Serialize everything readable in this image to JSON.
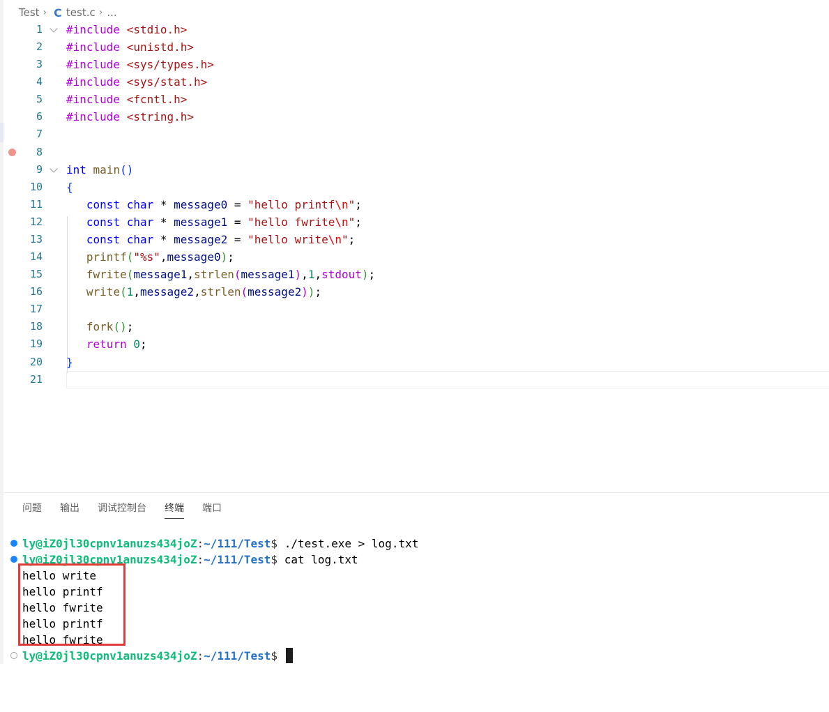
{
  "breadcrumb": {
    "folder": "Test",
    "file_icon": "C",
    "file": "test.c",
    "more": "..."
  },
  "editor": {
    "lines": [
      {
        "n": "1"
      },
      {
        "n": "2"
      },
      {
        "n": "3"
      },
      {
        "n": "4"
      },
      {
        "n": "5"
      },
      {
        "n": "6"
      },
      {
        "n": "7"
      },
      {
        "n": "8"
      },
      {
        "n": "9"
      },
      {
        "n": "10"
      },
      {
        "n": "11"
      },
      {
        "n": "12"
      },
      {
        "n": "13"
      },
      {
        "n": "14"
      },
      {
        "n": "15"
      },
      {
        "n": "16"
      },
      {
        "n": "17"
      },
      {
        "n": "18"
      },
      {
        "n": "19"
      },
      {
        "n": "20"
      },
      {
        "n": "21"
      }
    ],
    "includes": [
      "<stdio.h>",
      "<unistd.h>",
      "<sys/types.h>",
      "<sys/stat.h>",
      "<fcntl.h>",
      "<string.h>"
    ],
    "include_kw": "#include",
    "msg_strings": [
      "\"hello printf",
      "\"hello fwrite",
      "\"hello write"
    ],
    "esc": "\\n",
    "msg_names": [
      "message0",
      "message1",
      "message2"
    ],
    "printf_fmt": "\"%s\""
  },
  "panel": {
    "tabs": [
      "问题",
      "输出",
      "调试控制台",
      "终端",
      "端口"
    ],
    "active_tab": "终端"
  },
  "terminal": {
    "prompt_user": "ly@iZ0jl30cpnv1anuzs434joZ",
    "prompt_path": "~/111/Test",
    "commands": [
      "./test.exe > log.txt",
      "cat log.txt"
    ],
    "output": [
      "hello write",
      "hello printf",
      "hello fwrite",
      "hello printf",
      "hello fwrite"
    ]
  },
  "colors": {
    "accent_blue": "#1a85ff",
    "highlight_red": "#e13b3b",
    "prompt_green": "#0dbc79",
    "prompt_blue": "#2472c8"
  }
}
